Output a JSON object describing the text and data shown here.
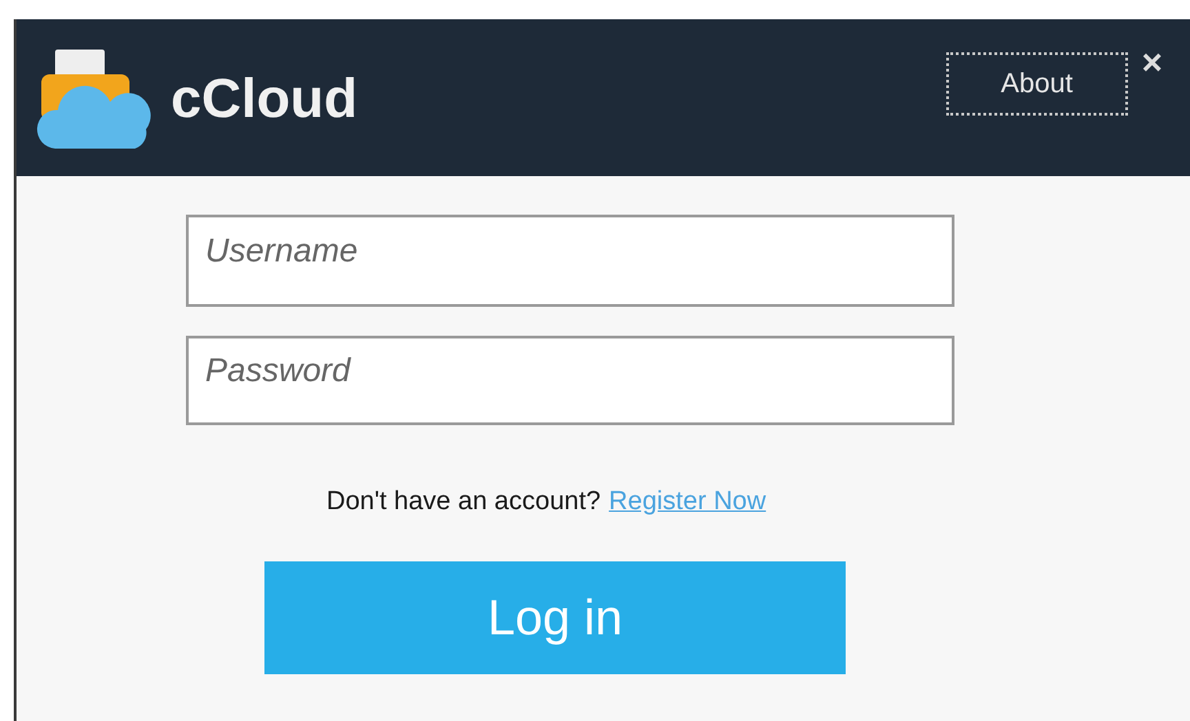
{
  "header": {
    "app_name": "cCloud",
    "about_button": "About",
    "close_button": "×"
  },
  "form": {
    "username": {
      "placeholder": "Username"
    },
    "password": {
      "placeholder": "Password"
    },
    "register_prompt": "Don't have an account?",
    "register_link": "Register Now",
    "login_button": "Log in"
  }
}
